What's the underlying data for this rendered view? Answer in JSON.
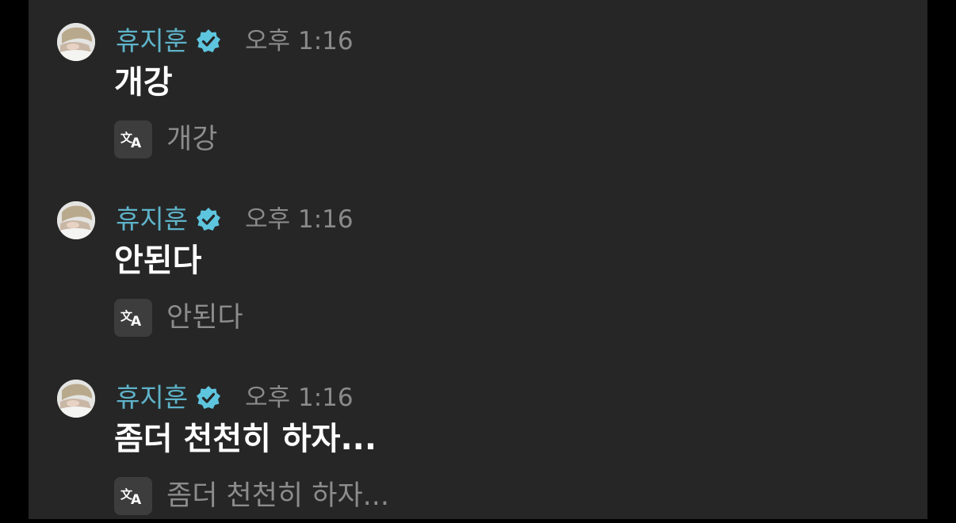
{
  "colors": {
    "background": "#262626",
    "name": "#5eb3c9",
    "verified_badge": "#5ec5de",
    "timestamp": "#8a8a8a",
    "message_text": "#ffffff",
    "translation_text": "#8c8c8c",
    "translate_icon_bg": "#3d3d3d"
  },
  "icons": {
    "avatar": "avatar",
    "verified": "verified-badge-icon",
    "translate": "translate-icon"
  },
  "messages": [
    {
      "sender": "휴지훈",
      "time": "오후 1:16",
      "text": "개강",
      "translation": "개강"
    },
    {
      "sender": "휴지훈",
      "time": "오후 1:16",
      "text": "안된다",
      "translation": "안된다"
    },
    {
      "sender": "휴지훈",
      "time": "오후 1:16",
      "text": "좀더 천천히 하자...",
      "translation": "좀더 천천히 하자..."
    }
  ]
}
